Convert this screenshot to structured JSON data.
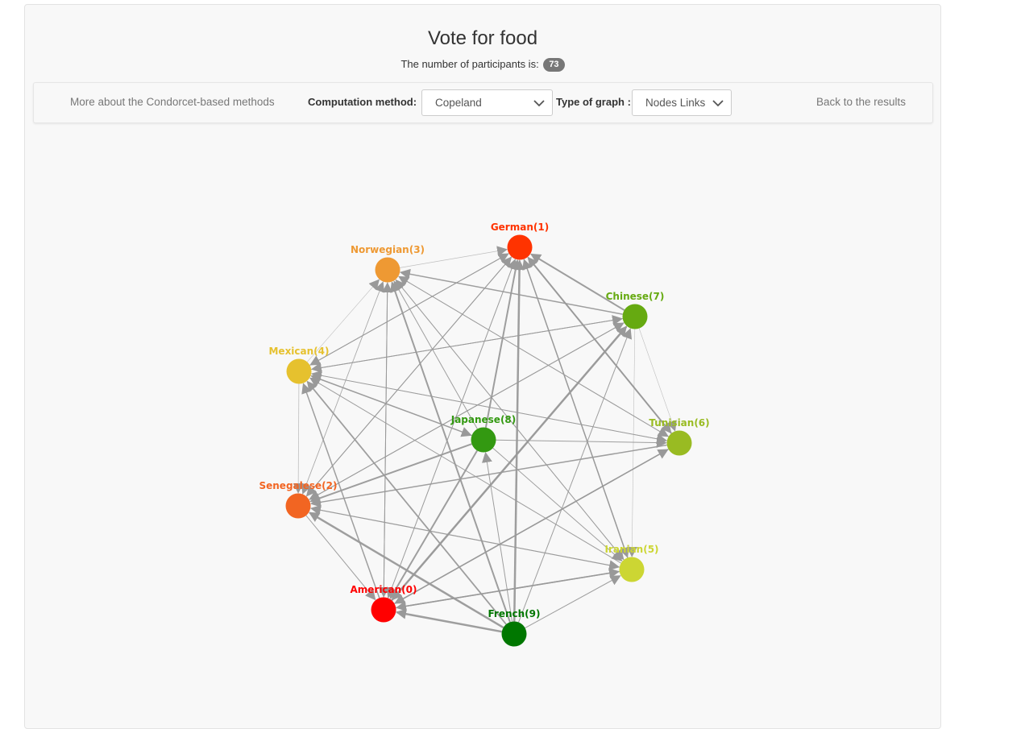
{
  "header": {
    "title": "Vote for food",
    "participants_text": "The number of participants is:",
    "participants_count": "73"
  },
  "toolbar": {
    "condorcet_link": "More about the Condorcet-based methods",
    "method_label": "Computation method:",
    "method_value": "Copeland",
    "graph_type_label": "Type of graph :",
    "graph_type_value": "Nodes Links",
    "back_link": "Back to the results"
  },
  "graph": {
    "nodes": [
      {
        "id": "german",
        "label": "German(1)",
        "color": "#ff3300"
      },
      {
        "id": "chinese",
        "label": "Chinese(7)",
        "color": "#66aa11"
      },
      {
        "id": "tunisian",
        "label": "Tunisian(6)",
        "color": "#99bb22"
      },
      {
        "id": "iranian",
        "label": "Iranian(5)",
        "color": "#ccd633"
      },
      {
        "id": "french",
        "label": "French(9)",
        "color": "#007700"
      },
      {
        "id": "american",
        "label": "American(0)",
        "color": "#ff0000"
      },
      {
        "id": "senegalese",
        "label": "Senegalese(2)",
        "color": "#f26522"
      },
      {
        "id": "mexican",
        "label": "Mexican(4)",
        "color": "#e6c12e"
      },
      {
        "id": "norwegian",
        "label": "Norwegian(3)",
        "color": "#ee9933"
      },
      {
        "id": "japanese",
        "label": "Japanese(8)",
        "color": "#339911"
      }
    ],
    "edges": [
      {
        "from": "chinese",
        "to": "german",
        "weight": 2
      },
      {
        "from": "tunisian",
        "to": "german",
        "weight": 2
      },
      {
        "from": "iranian",
        "to": "german",
        "weight": 1.5
      },
      {
        "from": "french",
        "to": "german",
        "weight": 2.5
      },
      {
        "from": "japanese",
        "to": "german",
        "weight": 2
      },
      {
        "from": "american",
        "to": "german",
        "weight": 1
      },
      {
        "from": "senegalese",
        "to": "german",
        "weight": 1
      },
      {
        "from": "mexican",
        "to": "german",
        "weight": 1
      },
      {
        "from": "norwegian",
        "to": "german",
        "weight": 0.8
      },
      {
        "from": "chinese",
        "to": "norwegian",
        "weight": 1.5
      },
      {
        "from": "tunisian",
        "to": "norwegian",
        "weight": 1
      },
      {
        "from": "iranian",
        "to": "norwegian",
        "weight": 1
      },
      {
        "from": "french",
        "to": "norwegian",
        "weight": 2
      },
      {
        "from": "japanese",
        "to": "norwegian",
        "weight": 1
      },
      {
        "from": "american",
        "to": "norwegian",
        "weight": 1
      },
      {
        "from": "senegalese",
        "to": "norwegian",
        "weight": 0.8
      },
      {
        "from": "mexican",
        "to": "norwegian",
        "weight": 0.6
      },
      {
        "from": "chinese",
        "to": "mexican",
        "weight": 1
      },
      {
        "from": "tunisian",
        "to": "mexican",
        "weight": 1
      },
      {
        "from": "iranian",
        "to": "mexican",
        "weight": 1
      },
      {
        "from": "french",
        "to": "mexican",
        "weight": 1.8
      },
      {
        "from": "japanese",
        "to": "mexican",
        "weight": 1.5
      },
      {
        "from": "american",
        "to": "mexican",
        "weight": 1.5
      },
      {
        "from": "german",
        "to": "mexican",
        "weight": 1
      },
      {
        "from": "chinese",
        "to": "senegalese",
        "weight": 1
      },
      {
        "from": "tunisian",
        "to": "senegalese",
        "weight": 1.5
      },
      {
        "from": "iranian",
        "to": "senegalese",
        "weight": 1.2
      },
      {
        "from": "french",
        "to": "senegalese",
        "weight": 2.5
      },
      {
        "from": "japanese",
        "to": "senegalese",
        "weight": 2
      },
      {
        "from": "german",
        "to": "senegalese",
        "weight": 1
      },
      {
        "from": "mexican",
        "to": "senegalese",
        "weight": 0.8
      },
      {
        "from": "norwegian",
        "to": "senegalese",
        "weight": 0.8
      },
      {
        "from": "german",
        "to": "american",
        "weight": 0.6
      },
      {
        "from": "norwegian",
        "to": "american",
        "weight": 1
      },
      {
        "from": "chinese",
        "to": "american",
        "weight": 1
      },
      {
        "from": "tunisian",
        "to": "american",
        "weight": 1.5
      },
      {
        "from": "iranian",
        "to": "american",
        "weight": 1.5
      },
      {
        "from": "french",
        "to": "american",
        "weight": 2.5
      },
      {
        "from": "japanese",
        "to": "american",
        "weight": 2
      },
      {
        "from": "senegalese",
        "to": "american",
        "weight": 1
      },
      {
        "from": "american",
        "to": "chinese",
        "weight": 2.5
      },
      {
        "from": "senegalese",
        "to": "chinese",
        "weight": 1
      },
      {
        "from": "mexican",
        "to": "chinese",
        "weight": 1
      },
      {
        "from": "french",
        "to": "japanese",
        "weight": 1
      },
      {
        "from": "japanese",
        "to": "tunisian",
        "weight": 1
      },
      {
        "from": "american",
        "to": "tunisian",
        "weight": 1.5
      },
      {
        "from": "german",
        "to": "tunisian",
        "weight": 1
      },
      {
        "from": "norwegian",
        "to": "tunisian",
        "weight": 0.8
      },
      {
        "from": "mexican",
        "to": "tunisian",
        "weight": 0.8
      },
      {
        "from": "chinese",
        "to": "tunisian",
        "weight": 0.6
      },
      {
        "from": "french",
        "to": "iranian",
        "weight": 1
      },
      {
        "from": "american",
        "to": "iranian",
        "weight": 1.5
      },
      {
        "from": "japanese",
        "to": "iranian",
        "weight": 1
      },
      {
        "from": "norwegian",
        "to": "iranian",
        "weight": 0.8
      },
      {
        "from": "senegalese",
        "to": "iranian",
        "weight": 0.8
      },
      {
        "from": "chinese",
        "to": "iranian",
        "weight": 0.6
      },
      {
        "from": "german",
        "to": "iranian",
        "weight": 1
      },
      {
        "from": "french",
        "to": "chinese",
        "weight": 1
      },
      {
        "from": "mexican",
        "to": "japanese",
        "weight": 0.6
      }
    ]
  }
}
